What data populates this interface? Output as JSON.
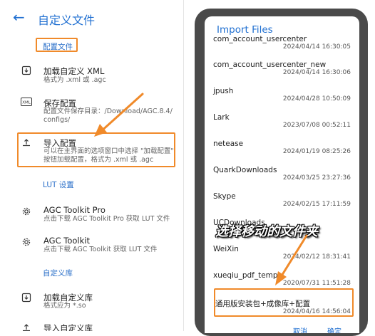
{
  "left": {
    "title": "自定义文件",
    "back_icon": "arrow-left-icon",
    "sections": {
      "config": "配置文件",
      "lut": "LUT 设置",
      "lib": "自定义库"
    },
    "items": [
      {
        "icon": "download-icon",
        "title": "加载自定义 XML",
        "sub1": "格式为 .xml 或 .agc",
        "sub2": ""
      },
      {
        "icon": "xml-icon",
        "title": "保存配置",
        "sub1": "配置文件保存目录：/Download/AGC.8.4/",
        "sub2": "configs/"
      },
      {
        "icon": "upload-icon",
        "title": "导入配置",
        "sub1": "可以在主界面的选项窗口中选择 \"加载配置\"",
        "sub2": "按钮加载配置，格式为 .xml 或 .agc"
      },
      {
        "icon": "gear-icon",
        "title": "AGC Toolkit Pro",
        "sub1": "点击下载 AGC Toolkit Pro 获取 LUT 文件",
        "sub2": ""
      },
      {
        "icon": "gear-icon",
        "title": "AGC Toolkit",
        "sub1": "点击下载 AGC Toolkit 获取 LUT 文件",
        "sub2": ""
      },
      {
        "icon": "download-icon",
        "title": "加载自定义库",
        "sub1": "格式应为 *.so",
        "sub2": ""
      },
      {
        "icon": "upload-icon",
        "title": "导入自定义库",
        "sub1": "",
        "sub2": ""
      }
    ]
  },
  "dialog": {
    "title": "Import Files",
    "files": [
      {
        "name": "com_account_usercenter",
        "date": "2024/04/14 16:30:05"
      },
      {
        "name": "com_account_usercenter_new",
        "date": "2024/04/14 16:30:06"
      },
      {
        "name": "jpush",
        "date": "2024/04/28 10:50:09"
      },
      {
        "name": "Lark",
        "date": "2023/07/08 00:52:11"
      },
      {
        "name": "netease",
        "date": "2024/01/19 08:25:26"
      },
      {
        "name": "QuarkDownloads",
        "date": "2024/03/25 23:27:36"
      },
      {
        "name": "Skype",
        "date": "2024/02/15 17:11:59"
      },
      {
        "name": "UCDownloads",
        "date": ""
      },
      {
        "name": "WeiXin",
        "date": "2024/02/12 18:31:41"
      },
      {
        "name": "xueqiu_pdf_temp",
        "date": "2020/07/31 11:51:28"
      },
      {
        "name": "通用版安装包+成像库+配置",
        "date": "2024/04/16 14:56:04"
      }
    ],
    "overlay": "选择移动的文件夹",
    "cancel": "取消",
    "confirm": "确定"
  },
  "colors": {
    "accent": "#1f6fd1",
    "highlight": "#f08a2a",
    "frame": "#4a4a4a"
  }
}
